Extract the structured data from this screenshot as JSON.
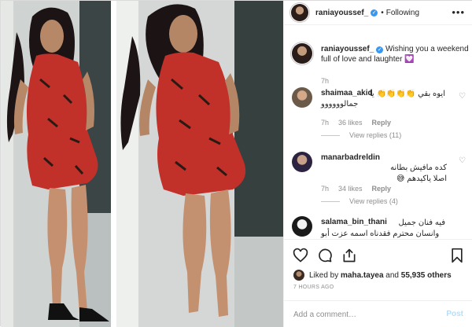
{
  "header": {
    "username": "raniayoussef_",
    "separator": "•",
    "follow_status": "Following",
    "more_label": "•••"
  },
  "caption": {
    "username": "raniayoussef_",
    "text": "Wishing you a weekend full of love and laughter 💟",
    "time": "7h"
  },
  "comments": [
    {
      "username": "shaimaa_akid",
      "text_line1": "ايوه بقي 👏👏👏👏 يا",
      "text_line2": "جمالوووووو",
      "time": "7h",
      "likes": "36 likes",
      "reply_label": "Reply",
      "view_replies": "View replies (11)"
    },
    {
      "username": "manarbadreldin",
      "text_line1": "كده مافيش بطانه",
      "text_line2": "اصلا ياكيدهم 😅",
      "time": "7h",
      "likes": "34 likes",
      "reply_label": "Reply",
      "view_replies": "View replies (4)"
    },
    {
      "username": "salama_bin_thani",
      "text_line1": "فيه فنان جميل",
      "text_line2": "وانسان محترم فقدناه اسمه عزت أبو"
    }
  ],
  "likes": {
    "prefix": "Liked by",
    "user": "maha.tayea",
    "middle": "and",
    "count": "55,935 others"
  },
  "timestamp": "7 HOURS AGO",
  "add_comment": {
    "placeholder": "Add a comment…",
    "post_label": "Post"
  },
  "icons": {
    "verified": "verified-badge-icon",
    "like": "heart-icon",
    "comment": "comment-bubble-icon",
    "share": "share-icon",
    "save": "bookmark-icon"
  },
  "colors": {
    "verified_blue": "#3897f0",
    "post_disabled": "#b2dffc",
    "secondary_text": "#8e8e8e",
    "dress_red": "#c2302a"
  }
}
